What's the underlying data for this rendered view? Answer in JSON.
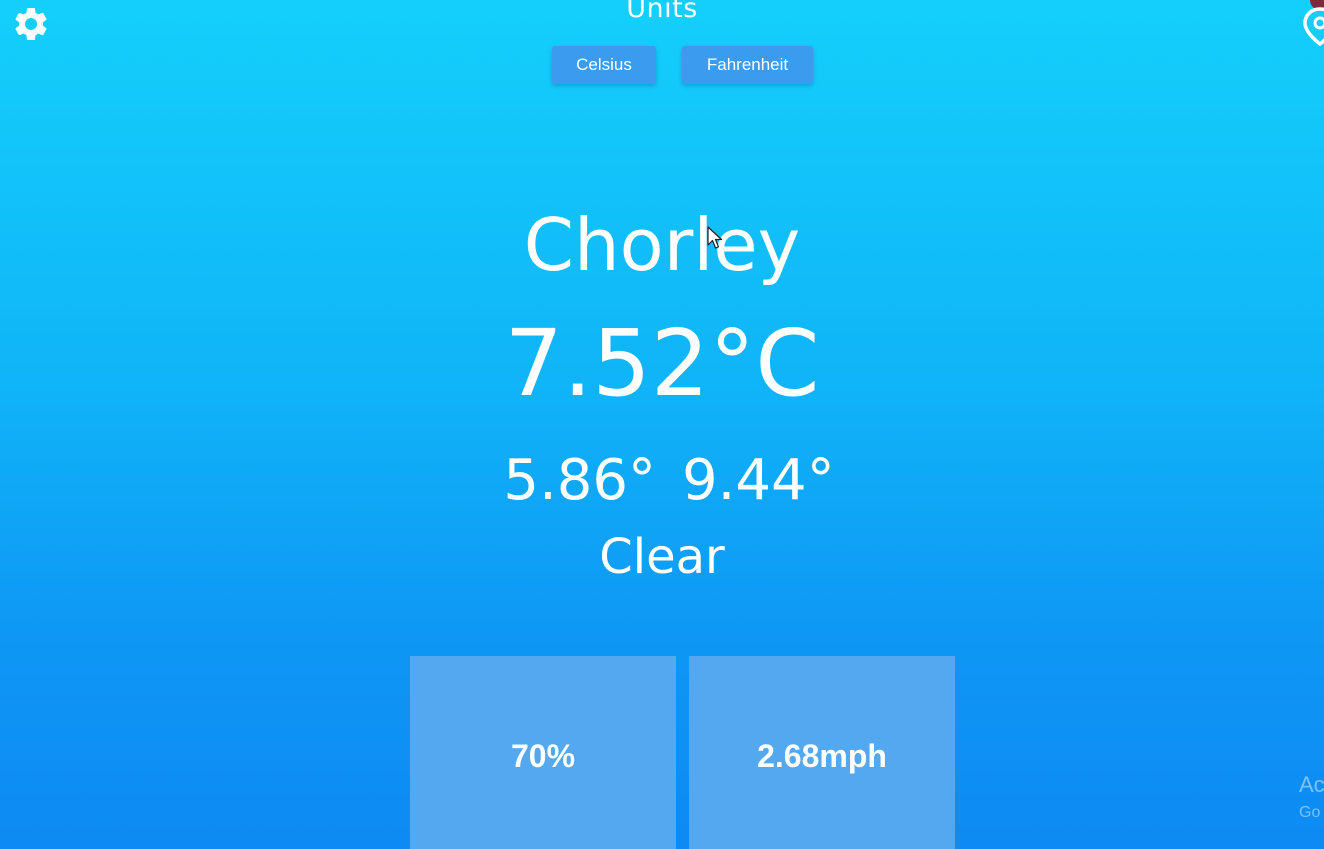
{
  "header": {
    "title": "Units",
    "settings_icon": "gear-icon",
    "location_icon": "location-pin-icon"
  },
  "units": {
    "celsius_label": "Celsius",
    "fahrenheit_label": "Fahrenheit"
  },
  "weather": {
    "city": "Chorley",
    "temperature": "7.52°C",
    "temp_min": "5.86°",
    "temp_max": "9.44°",
    "condition": "Clear"
  },
  "stats": {
    "humidity": "70%",
    "wind_speed": "2.68mph"
  },
  "watermark": {
    "line1": "Ac",
    "line2": "Go"
  },
  "colors": {
    "background_top": "#14cffb",
    "background_bottom": "#0d8af3",
    "button": "#3a9bef",
    "tile": "#54a8f0",
    "text": "#ffffff"
  }
}
